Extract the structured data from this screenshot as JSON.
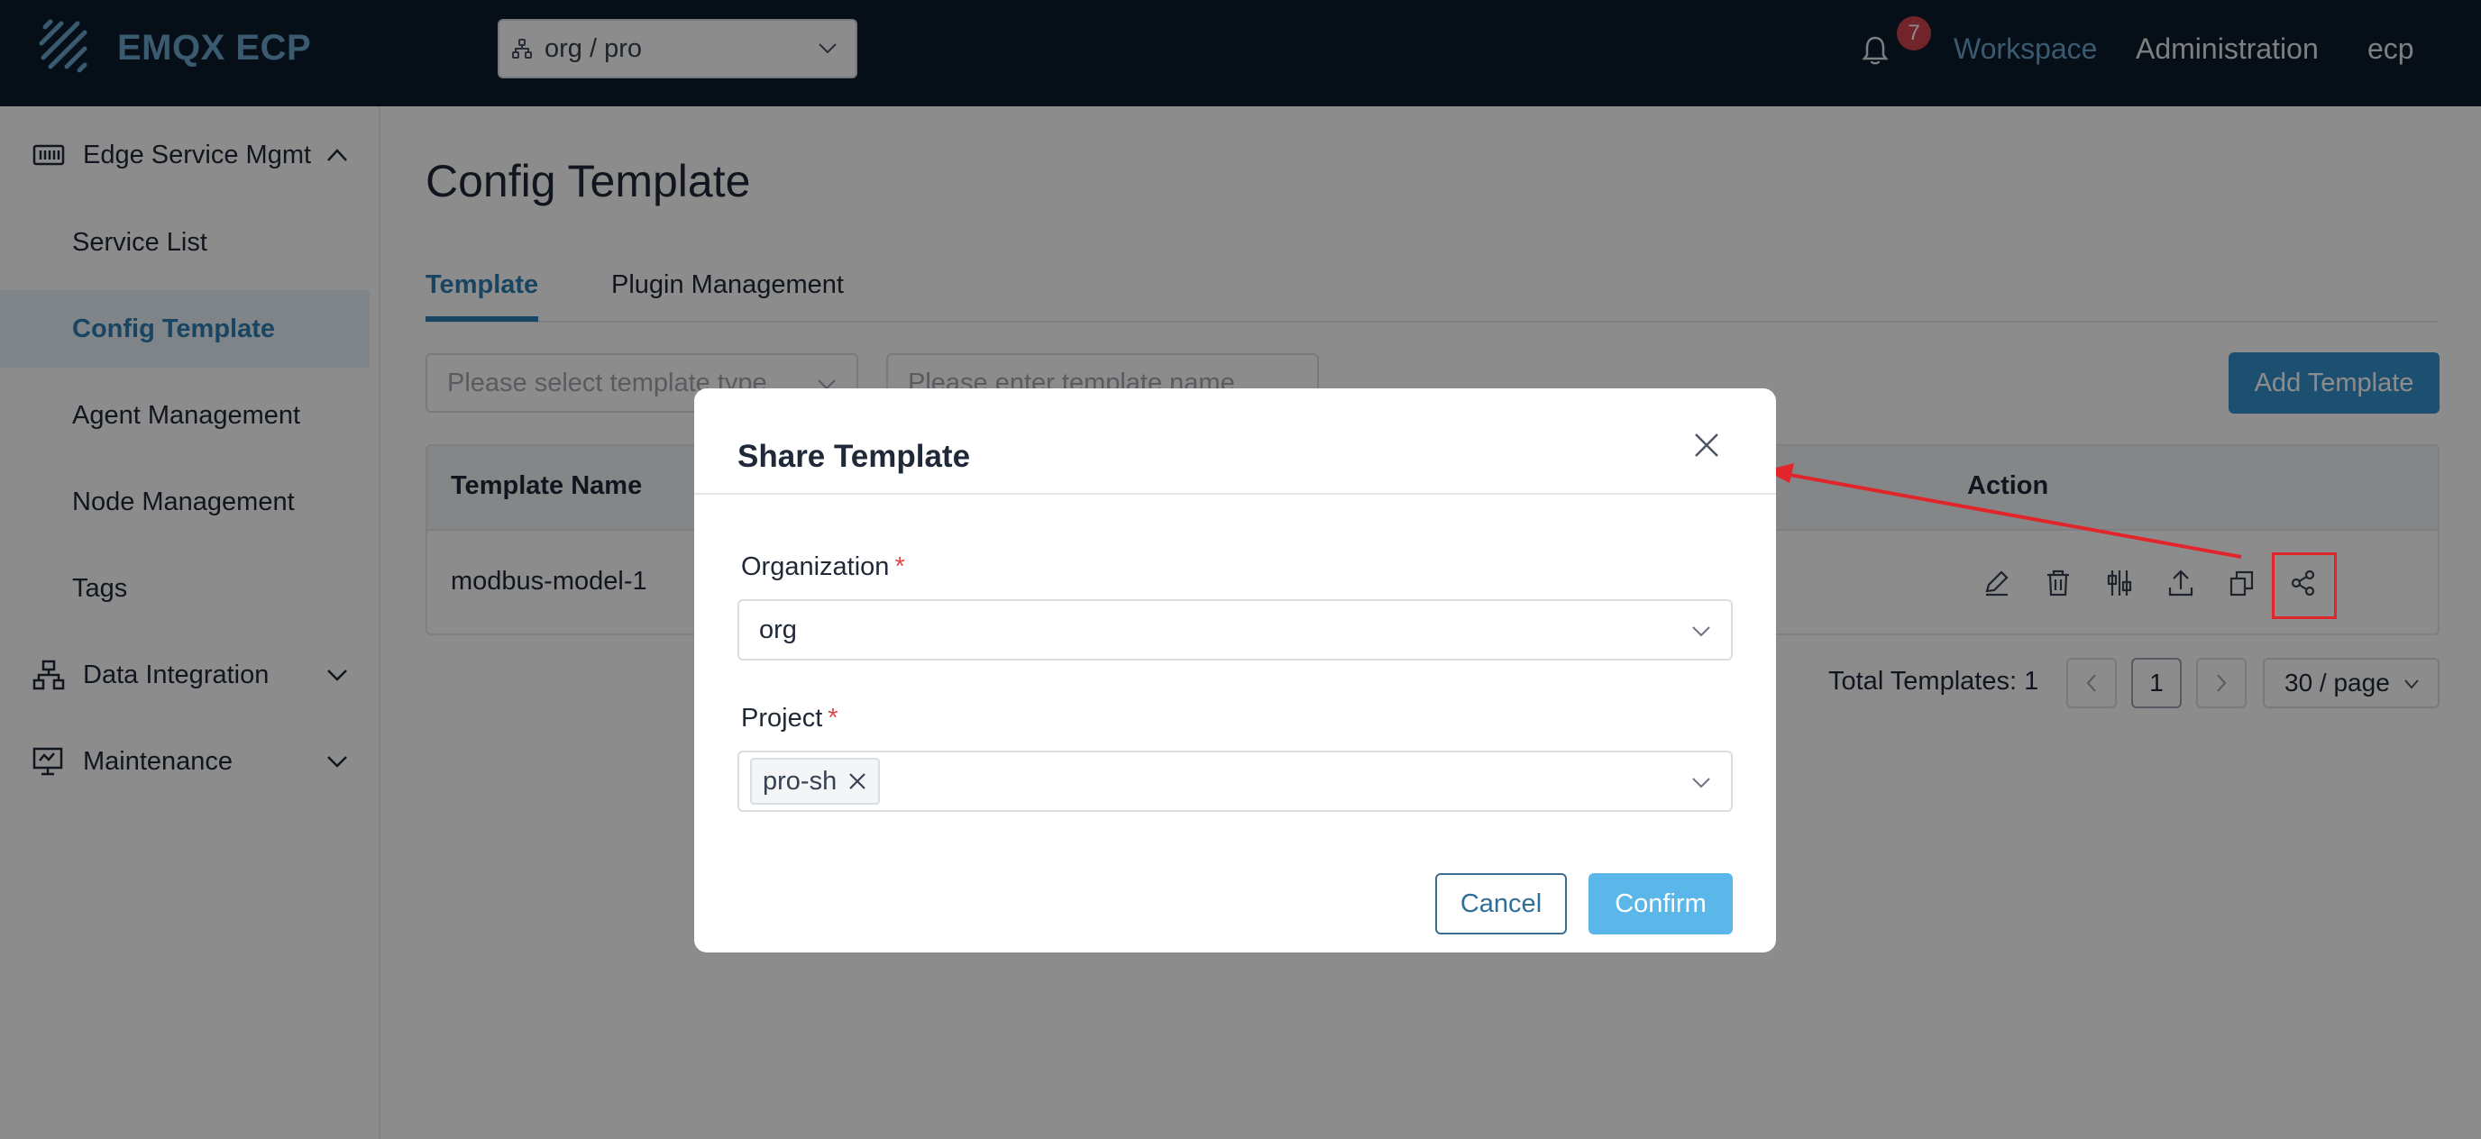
{
  "header": {
    "app_name": "EMQX ECP",
    "org_selector": "org / pro",
    "notification_count": "7",
    "nav": [
      "Workspace",
      "Administration",
      "ecp"
    ]
  },
  "sidebar": {
    "groups": [
      {
        "label": "Edge Service Mgmt",
        "icon": "edge-service-icon",
        "expanded": true
      },
      {
        "label": "Data Integration",
        "icon": "data-integration-icon",
        "expanded": false
      },
      {
        "label": "Maintenance",
        "icon": "maintenance-icon",
        "expanded": false
      }
    ],
    "items": [
      "Service List",
      "Config Template",
      "Agent Management",
      "Node Management",
      "Tags"
    ],
    "active_item": "Config Template"
  },
  "main": {
    "title": "Config Template",
    "tabs": [
      "Template",
      "Plugin Management"
    ],
    "active_tab": "Template",
    "filters": {
      "type_placeholder": "Please select template type",
      "name_placeholder": "Please enter template name"
    },
    "add_button": "Add Template",
    "table": {
      "headers": [
        "Template Name",
        "Action"
      ],
      "rows": [
        {
          "name": "modbus-model-1",
          "actions": [
            "edit-icon",
            "delete-icon",
            "config-icon",
            "upload-icon",
            "copy-icon",
            "share-icon"
          ]
        }
      ]
    },
    "pagination": {
      "total": "Total Templates: 1",
      "current_page": "1",
      "page_size": "30 / page"
    }
  },
  "modal": {
    "title": "Share Template",
    "organization_label": "Organization",
    "organization_value": "org",
    "project_label": "Project",
    "project_tags": [
      "pro-sh"
    ],
    "required_mark": "*",
    "cancel": "Cancel",
    "confirm": "Confirm"
  },
  "annotation": {
    "highlight": "share-icon",
    "color": "#e0262b"
  },
  "colors": {
    "topbar": "#0b1a2b",
    "accent": "#2e7fb4",
    "primary_button": "#3593cd",
    "confirm_button": "#5bb7ea",
    "badge": "#d0434f"
  }
}
